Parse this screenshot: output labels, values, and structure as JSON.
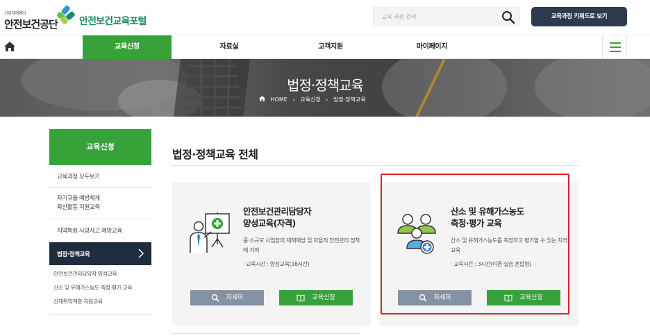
{
  "header": {
    "org_small": "산업재해예방",
    "org_name": "안전보건공단",
    "portal_name": "안전보건교육포털",
    "search_placeholder": "교육 과정 검색",
    "keyword_button": "교육과정 키워드로 보기"
  },
  "nav": {
    "items": [
      {
        "label": "교육신청",
        "active": true
      },
      {
        "label": "자료실"
      },
      {
        "label": "고객지원"
      },
      {
        "label": "마이페이지"
      }
    ]
  },
  "banner": {
    "title": "법정·정책교육",
    "breadcrumb": [
      "HOME",
      "교육신청",
      "법정·정책교육"
    ]
  },
  "sidebar": {
    "title": "교육신청",
    "items": [
      {
        "label": "교육과정 모두보기"
      },
      {
        "label": "자기규율 예방체계",
        "label2": "확산활동 지원교육"
      },
      {
        "label": "지역특화 사망사고 예방교육"
      },
      {
        "label": "법정·정책교육",
        "active": true
      }
    ],
    "subitems": [
      {
        "label": "안전보건관리담당자 양성교육"
      },
      {
        "label": "산소 및 유해가스농도 측정·평가 교육"
      },
      {
        "label": "산재취약계층 지원교육"
      }
    ]
  },
  "main": {
    "heading": "법정·정책교육 전체",
    "cards": [
      {
        "title_line1": "안전보건관리담당자",
        "title_line2": "양성교육(자격)",
        "desc": "중·소규모 사업장의 재해예방 및 자율적 안전관리 정착에 기여",
        "meta": "· 교육시간 : 양성교육(16시간)",
        "detail_label": "자세히",
        "apply_label": "교육신청",
        "icon": "presentation-icon"
      },
      {
        "title_line1": "산소 및 유해가스농도",
        "title_line2": "측정·평가 교육",
        "desc": "산소 및 유해가스농도를 측정하고 평가할 수 있는 자격교육",
        "meta": "· 교육시간 : 3시간(이론·실습 혼합형)",
        "detail_label": "자세히",
        "apply_label": "교육신청",
        "icon": "people-medical-icon"
      }
    ]
  },
  "colors": {
    "green": "#37a13a",
    "navy": "#1f2c3d",
    "button_gray": "#8492a3",
    "highlight_red": "#d9222a"
  }
}
